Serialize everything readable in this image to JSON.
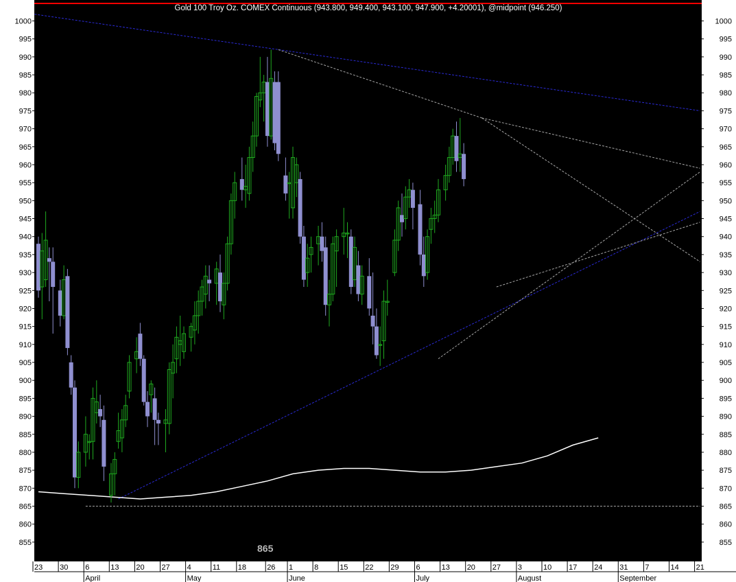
{
  "colors": {
    "background": "#000000",
    "frame": "#ffffff",
    "up_candle": "#1faa1f",
    "down_candle": "#8f8fd0",
    "top_line": "#ff0000",
    "blue_trend": "#2a2ad6",
    "grey_trend": "#a6a6a6",
    "moving_average": "#ffffff",
    "axis_text": "#000000"
  },
  "chart_data": {
    "type": "candlestick",
    "title": "Gold 100 Troy Oz. COMEX Continuous (943.800, 949.400, 943.100, 947.900, +4.20001), @midpoint (946.250)",
    "annotation": "865",
    "ylim": [
      853,
      1004
    ],
    "y_ticks": [
      855,
      860,
      865,
      870,
      875,
      880,
      885,
      890,
      895,
      900,
      905,
      910,
      915,
      920,
      925,
      930,
      935,
      940,
      945,
      950,
      955,
      960,
      965,
      970,
      975,
      980,
      985,
      990,
      995,
      1000
    ],
    "x_day_ticks": [
      {
        "label": "23",
        "day": 0
      },
      {
        "label": "30",
        "day": 7
      },
      {
        "label": "6",
        "day": 14
      },
      {
        "label": "13",
        "day": 21
      },
      {
        "label": "20",
        "day": 28
      },
      {
        "label": "27",
        "day": 35
      },
      {
        "label": "4",
        "day": 42
      },
      {
        "label": "11",
        "day": 49
      },
      {
        "label": "18",
        "day": 56
      },
      {
        "label": "26",
        "day": 64
      },
      {
        "label": "1",
        "day": 70
      },
      {
        "label": "8",
        "day": 77
      },
      {
        "label": "15",
        "day": 84
      },
      {
        "label": "22",
        "day": 91
      },
      {
        "label": "29",
        "day": 98
      },
      {
        "label": "6",
        "day": 105
      },
      {
        "label": "13",
        "day": 112
      },
      {
        "label": "20",
        "day": 119
      },
      {
        "label": "27",
        "day": 126
      },
      {
        "label": "3",
        "day": 133
      },
      {
        "label": "10",
        "day": 140
      },
      {
        "label": "17",
        "day": 147
      },
      {
        "label": "24",
        "day": 154
      },
      {
        "label": "31",
        "day": 161
      },
      {
        "label": "7",
        "day": 168
      },
      {
        "label": "14",
        "day": 175
      },
      {
        "label": "21",
        "day": 182
      }
    ],
    "x_month_labels": [
      {
        "label": "April",
        "day": 14
      },
      {
        "label": "May",
        "day": 42
      },
      {
        "label": "June",
        "day": 70
      },
      {
        "label": "July",
        "day": 105
      },
      {
        "label": "August",
        "day": 133
      },
      {
        "label": "September",
        "day": 161
      }
    ],
    "candles": [
      {
        "day": 0,
        "o": 938,
        "h": 940,
        "l": 923,
        "c": 925
      },
      {
        "day": 1,
        "o": 926,
        "h": 941,
        "l": 917,
        "c": 936
      },
      {
        "day": 2,
        "o": 928,
        "h": 947,
        "l": 926,
        "c": 939
      },
      {
        "day": 3,
        "o": 934,
        "h": 937,
        "l": 922,
        "c": 933
      },
      {
        "day": 4,
        "o": 933,
        "h": 937,
        "l": 913,
        "c": 926
      },
      {
        "day": 6,
        "o": 925,
        "h": 928,
        "l": 915,
        "c": 918
      },
      {
        "day": 7,
        "o": 918,
        "h": 932,
        "l": 917,
        "c": 928
      },
      {
        "day": 8,
        "o": 929,
        "h": 931,
        "l": 907,
        "c": 909
      },
      {
        "day": 9,
        "o": 905,
        "h": 907,
        "l": 896,
        "c": 898
      },
      {
        "day": 10,
        "o": 898,
        "h": 900,
        "l": 870,
        "c": 873
      },
      {
        "day": 11,
        "o": 873,
        "h": 883,
        "l": 870,
        "c": 880
      },
      {
        "day": 13,
        "o": 880,
        "h": 890,
        "l": 876,
        "c": 885
      },
      {
        "day": 14,
        "o": 883,
        "h": 885,
        "l": 878,
        "c": 883
      },
      {
        "day": 15,
        "o": 883,
        "h": 898,
        "l": 878,
        "c": 895
      },
      {
        "day": 16,
        "o": 891,
        "h": 900,
        "l": 888,
        "c": 894
      },
      {
        "day": 17,
        "o": 892,
        "h": 896,
        "l": 887,
        "c": 890
      },
      {
        "day": 18,
        "o": 889,
        "h": 893,
        "l": 872,
        "c": 876
      },
      {
        "day": 20,
        "o": 868,
        "h": 877,
        "l": 866,
        "c": 874
      },
      {
        "day": 21,
        "o": 874,
        "h": 880,
        "l": 868,
        "c": 878
      },
      {
        "day": 22,
        "o": 883,
        "h": 891,
        "l": 881,
        "c": 886
      },
      {
        "day": 23,
        "o": 884,
        "h": 892,
        "l": 880,
        "c": 889
      },
      {
        "day": 24,
        "o": 889,
        "h": 896,
        "l": 887,
        "c": 893
      },
      {
        "day": 25,
        "o": 897,
        "h": 907,
        "l": 895,
        "c": 905
      },
      {
        "day": 27,
        "o": 906,
        "h": 912,
        "l": 902,
        "c": 908
      },
      {
        "day": 28,
        "o": 913,
        "h": 916,
        "l": 904,
        "c": 906
      },
      {
        "day": 29,
        "o": 906,
        "h": 907,
        "l": 893,
        "c": 894
      },
      {
        "day": 30,
        "o": 894,
        "h": 897,
        "l": 887,
        "c": 890
      },
      {
        "day": 31,
        "o": 896,
        "h": 900,
        "l": 891,
        "c": 899
      },
      {
        "day": 32,
        "o": 895,
        "h": 898,
        "l": 882,
        "c": 889
      },
      {
        "day": 33,
        "o": 889,
        "h": 891,
        "l": 882,
        "c": 888
      },
      {
        "day": 35,
        "o": 888,
        "h": 892,
        "l": 880,
        "c": 889
      },
      {
        "day": 36,
        "o": 888,
        "h": 905,
        "l": 885,
        "c": 903
      },
      {
        "day": 37,
        "o": 902,
        "h": 910,
        "l": 895,
        "c": 905
      },
      {
        "day": 38,
        "o": 906,
        "h": 915,
        "l": 902,
        "c": 912
      },
      {
        "day": 39,
        "o": 910,
        "h": 918,
        "l": 904,
        "c": 911
      },
      {
        "day": 40,
        "o": 908,
        "h": 915,
        "l": 906,
        "c": 913
      },
      {
        "day": 42,
        "o": 912,
        "h": 916,
        "l": 908,
        "c": 915
      },
      {
        "day": 43,
        "o": 914,
        "h": 922,
        "l": 910,
        "c": 918
      },
      {
        "day": 44,
        "o": 918,
        "h": 925,
        "l": 913,
        "c": 922
      },
      {
        "day": 45,
        "o": 922,
        "h": 928,
        "l": 918,
        "c": 926
      },
      {
        "day": 46,
        "o": 924,
        "h": 932,
        "l": 920,
        "c": 929
      },
      {
        "day": 47,
        "o": 928,
        "h": 932,
        "l": 922,
        "c": 927
      },
      {
        "day": 49,
        "o": 927,
        "h": 933,
        "l": 921,
        "c": 931
      },
      {
        "day": 50,
        "o": 930,
        "h": 935,
        "l": 919,
        "c": 922
      },
      {
        "day": 51,
        "o": 921,
        "h": 930,
        "l": 917,
        "c": 927
      },
      {
        "day": 52,
        "o": 927,
        "h": 940,
        "l": 925,
        "c": 938
      },
      {
        "day": 53,
        "o": 938,
        "h": 952,
        "l": 935,
        "c": 950
      },
      {
        "day": 54,
        "o": 950,
        "h": 958,
        "l": 945,
        "c": 955
      },
      {
        "day": 56,
        "o": 956,
        "h": 962,
        "l": 950,
        "c": 953
      },
      {
        "day": 57,
        "o": 953,
        "h": 960,
        "l": 948,
        "c": 954
      },
      {
        "day": 58,
        "o": 952,
        "h": 965,
        "l": 950,
        "c": 962
      },
      {
        "day": 59,
        "o": 962,
        "h": 972,
        "l": 958,
        "c": 968
      },
      {
        "day": 60,
        "o": 968,
        "h": 980,
        "l": 965,
        "c": 979
      },
      {
        "day": 61,
        "o": 978,
        "h": 990,
        "l": 976,
        "c": 980
      },
      {
        "day": 62,
        "o": 980,
        "h": 985,
        "l": 972,
        "c": 983
      },
      {
        "day": 63,
        "o": 983,
        "h": 990,
        "l": 965,
        "c": 968
      },
      {
        "day": 64,
        "o": 968,
        "h": 992,
        "l": 967,
        "c": 984
      },
      {
        "day": 65,
        "o": 983,
        "h": 986,
        "l": 964,
        "c": 966
      },
      {
        "day": 66,
        "o": 983,
        "h": 986,
        "l": 961,
        "c": 963
      },
      {
        "day": 68,
        "o": 957,
        "h": 962,
        "l": 950,
        "c": 952
      },
      {
        "day": 69,
        "o": 955,
        "h": 958,
        "l": 945,
        "c": 955
      },
      {
        "day": 70,
        "o": 948,
        "h": 965,
        "l": 945,
        "c": 962
      },
      {
        "day": 71,
        "o": 955,
        "h": 962,
        "l": 951,
        "c": 960
      },
      {
        "day": 72,
        "o": 956,
        "h": 958,
        "l": 938,
        "c": 940
      },
      {
        "day": 73,
        "o": 940,
        "h": 943,
        "l": 926,
        "c": 928
      },
      {
        "day": 74,
        "o": 930,
        "h": 938,
        "l": 926,
        "c": 934
      },
      {
        "day": 75,
        "o": 935,
        "h": 940,
        "l": 930,
        "c": 937
      },
      {
        "day": 77,
        "o": 938,
        "h": 943,
        "l": 932,
        "c": 940
      },
      {
        "day": 78,
        "o": 940,
        "h": 944,
        "l": 933,
        "c": 936
      },
      {
        "day": 79,
        "o": 937,
        "h": 940,
        "l": 918,
        "c": 921
      },
      {
        "day": 80,
        "o": 921,
        "h": 928,
        "l": 915,
        "c": 924
      },
      {
        "day": 81,
        "o": 924,
        "h": 940,
        "l": 922,
        "c": 938
      },
      {
        "day": 82,
        "o": 936,
        "h": 942,
        "l": 926,
        "c": 940
      },
      {
        "day": 84,
        "o": 940,
        "h": 948,
        "l": 935,
        "c": 941
      },
      {
        "day": 85,
        "o": 941,
        "h": 944,
        "l": 934,
        "c": 941
      },
      {
        "day": 86,
        "o": 940,
        "h": 942,
        "l": 924,
        "c": 926
      },
      {
        "day": 87,
        "o": 928,
        "h": 940,
        "l": 926,
        "c": 937
      },
      {
        "day": 88,
        "o": 932,
        "h": 936,
        "l": 922,
        "c": 924
      },
      {
        "day": 89,
        "o": 924,
        "h": 932,
        "l": 921,
        "c": 929
      },
      {
        "day": 91,
        "o": 929,
        "h": 934,
        "l": 918,
        "c": 920
      },
      {
        "day": 92,
        "o": 918,
        "h": 930,
        "l": 910,
        "c": 915
      },
      {
        "day": 93,
        "o": 915,
        "h": 920,
        "l": 906,
        "c": 907
      },
      {
        "day": 94,
        "o": 910,
        "h": 915,
        "l": 904,
        "c": 910
      },
      {
        "day": 95,
        "o": 911,
        "h": 925,
        "l": 906,
        "c": 922
      },
      {
        "day": 96,
        "o": 922,
        "h": 928,
        "l": 918,
        "c": 922
      }
    ],
    "candles_late": [
      {
        "day": 98,
        "o": 930,
        "h": 942,
        "l": 929,
        "c": 939
      },
      {
        "day": 99,
        "o": 939,
        "h": 950,
        "l": 936,
        "c": 948
      },
      {
        "day": 100,
        "o": 946,
        "h": 952,
        "l": 940,
        "c": 944
      },
      {
        "day": 101,
        "o": 945,
        "h": 954,
        "l": 942,
        "c": 951
      },
      {
        "day": 102,
        "o": 951,
        "h": 956,
        "l": 948,
        "c": 953
      },
      {
        "day": 103,
        "o": 953,
        "h": 955,
        "l": 942,
        "c": 948
      },
      {
        "day": 105,
        "o": 949,
        "h": 953,
        "l": 932,
        "c": 935
      },
      {
        "day": 106,
        "o": 935,
        "h": 940,
        "l": 926,
        "c": 929
      },
      {
        "day": 107,
        "o": 930,
        "h": 942,
        "l": 928,
        "c": 940
      },
      {
        "day": 108,
        "o": 942,
        "h": 948,
        "l": 938,
        "c": 945
      },
      {
        "day": 109,
        "o": 945,
        "h": 950,
        "l": 941,
        "c": 946
      },
      {
        "day": 110,
        "o": 946,
        "h": 956,
        "l": 944,
        "c": 953
      },
      {
        "day": 112,
        "o": 953,
        "h": 960,
        "l": 950,
        "c": 957
      },
      {
        "day": 113,
        "o": 957,
        "h": 965,
        "l": 955,
        "c": 962
      },
      {
        "day": 114,
        "o": 962,
        "h": 970,
        "l": 960,
        "c": 968
      },
      {
        "day": 115,
        "o": 968,
        "h": 972,
        "l": 958,
        "c": 961
      },
      {
        "day": 116,
        "o": 962,
        "h": 973,
        "l": 958,
        "c": 963
      },
      {
        "day": 117,
        "o": 963,
        "h": 966,
        "l": 954,
        "c": 956
      }
    ],
    "moving_average": [
      {
        "day": 0,
        "v": 869
      },
      {
        "day": 7,
        "v": 868.5
      },
      {
        "day": 14,
        "v": 868
      },
      {
        "day": 21,
        "v": 867.5
      },
      {
        "day": 28,
        "v": 867
      },
      {
        "day": 35,
        "v": 867.5
      },
      {
        "day": 42,
        "v": 868
      },
      {
        "day": 49,
        "v": 869
      },
      {
        "day": 56,
        "v": 870.5
      },
      {
        "day": 63,
        "v": 872
      },
      {
        "day": 70,
        "v": 874
      },
      {
        "day": 77,
        "v": 875
      },
      {
        "day": 84,
        "v": 875.5
      },
      {
        "day": 91,
        "v": 875.5
      },
      {
        "day": 98,
        "v": 875
      },
      {
        "day": 105,
        "v": 874.5
      },
      {
        "day": 112,
        "v": 874.5
      },
      {
        "day": 119,
        "v": 875
      },
      {
        "day": 126,
        "v": 876
      },
      {
        "day": 133,
        "v": 877
      },
      {
        "day": 140,
        "v": 879
      },
      {
        "day": 147,
        "v": 882
      },
      {
        "day": 154,
        "v": 884
      }
    ],
    "trend_lines": [
      {
        "style": "blue",
        "from": {
          "day": -2,
          "v": 1002
        },
        "to": {
          "day": 182,
          "v": 975
        }
      },
      {
        "style": "blue",
        "from": {
          "day": 22,
          "v": 867
        },
        "to": {
          "day": 182,
          "v": 947
        }
      },
      {
        "style": "grey",
        "from": {
          "day": 66,
          "v": 992
        },
        "to": {
          "day": 122,
          "v": 973
        }
      },
      {
        "style": "grey",
        "from": {
          "day": 122,
          "v": 973
        },
        "to": {
          "day": 182,
          "v": 959
        }
      },
      {
        "style": "grey",
        "from": {
          "day": 122,
          "v": 973
        },
        "to": {
          "day": 182,
          "v": 933
        }
      },
      {
        "style": "grey",
        "from": {
          "day": 110,
          "v": 906
        },
        "to": {
          "day": 182,
          "v": 958
        }
      },
      {
        "style": "grey",
        "from": {
          "day": 126,
          "v": 926
        },
        "to": {
          "day": 182,
          "v": 944
        }
      },
      {
        "style": "grey",
        "from": {
          "day": 13,
          "v": 865
        },
        "to": {
          "day": 182,
          "v": 865
        }
      }
    ]
  }
}
